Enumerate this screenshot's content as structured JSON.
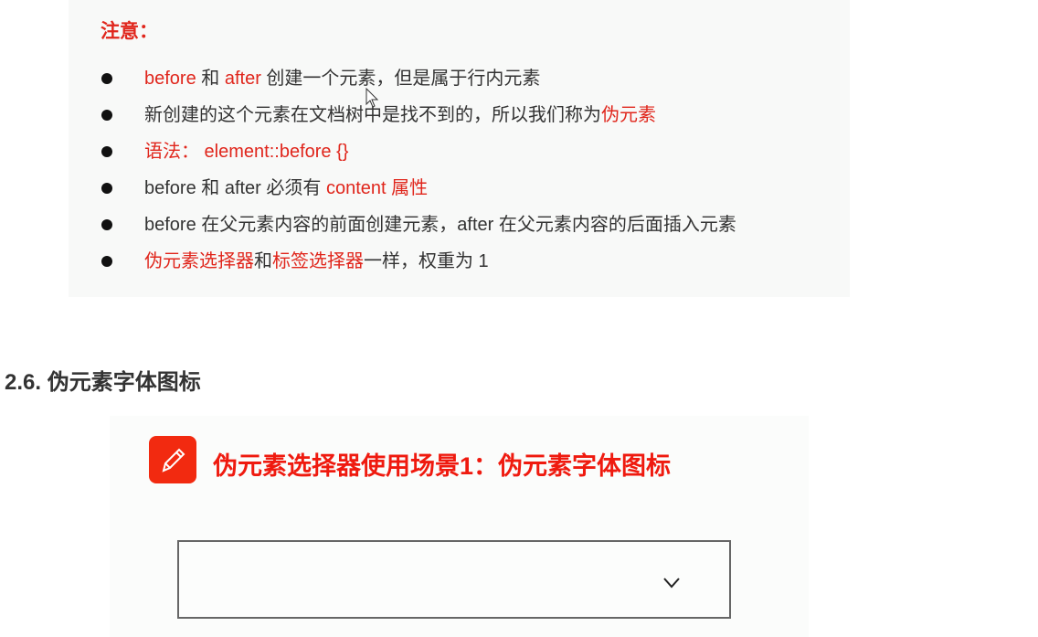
{
  "note_title": "注意：",
  "bullets": [
    [
      {
        "t": "before",
        "red": true
      },
      {
        "t": " 和 "
      },
      {
        "t": "after",
        "red": true
      },
      {
        "t": " 创建一个元素，但是属于行内元素"
      }
    ],
    [
      {
        "t": "新创建的这个元素在文档树中是找不到的，所以我们称为"
      },
      {
        "t": "伪元素",
        "red": true
      }
    ],
    [
      {
        "t": "语法：  element::before {}",
        "red": true
      }
    ],
    [
      {
        "t": "before 和 after 必须有 "
      },
      {
        "t": "content 属性",
        "red": true
      }
    ],
    [
      {
        "t": "before 在父元素内容的前面创建元素，after 在父元素内容的后面插入元素"
      }
    ],
    [
      {
        "t": "伪元素选择器",
        "red": true
      },
      {
        "t": "和"
      },
      {
        "t": "标签选择器",
        "red": true
      },
      {
        "t": "一样，权重为 1"
      }
    ]
  ],
  "section_heading": "2.6. 伪元素字体图标",
  "slide2": {
    "title": "伪元素选择器使用场景1：伪元素字体图标",
    "icon": "pencil-icon"
  },
  "colors": {
    "accent": "#e0261c"
  }
}
